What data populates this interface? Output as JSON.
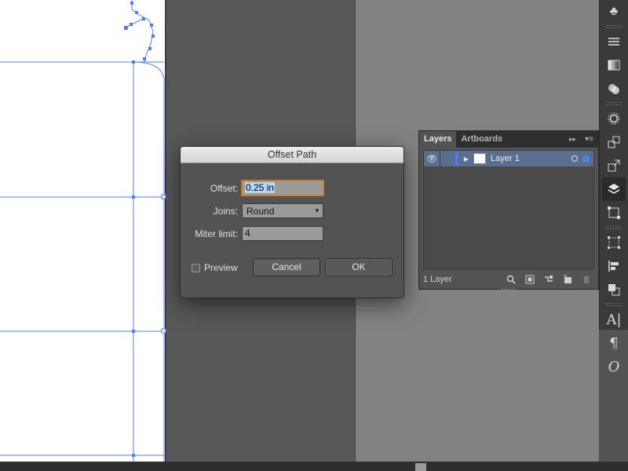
{
  "dialog": {
    "title": "Offset Path",
    "offset_label": "Offset:",
    "offset_value": "0.25 in",
    "joins_label": "Joins:",
    "joins_value": "Round",
    "miter_label": "Miter limit:",
    "miter_value": "4",
    "preview_label": "Preview",
    "preview_checked": false,
    "cancel_label": "Cancel",
    "ok_label": "OK"
  },
  "layers_panel": {
    "tabs": [
      {
        "label": "Layers",
        "active": true
      },
      {
        "label": "Artboards",
        "active": false
      }
    ],
    "collapse_glyph": "▸▸",
    "menu_glyph": "▾≡",
    "layers": [
      {
        "name": "Layer 1",
        "visible": true,
        "color": "#4f7dff"
      }
    ],
    "count_text": "1 Layer"
  },
  "tool_strip": {
    "tools": [
      "clubs-icon",
      "menu-lines-icon",
      "gradient-icon",
      "transparency-icon",
      "appearance-sun-icon",
      "export-icon",
      "layers-icon",
      "transform-icon",
      "align-icon",
      "pathfinder-icon",
      "character-icon",
      "paragraph-icon",
      "opentype-icon"
    ],
    "glyphs": {
      "clubs": "♣",
      "character": "A|",
      "paragraph": "¶",
      "opentype": "O"
    }
  },
  "colors": {
    "selection_blue": "#3f7fdc",
    "focus_orange": "#d7891f",
    "layer_color": "#4f7dff"
  }
}
